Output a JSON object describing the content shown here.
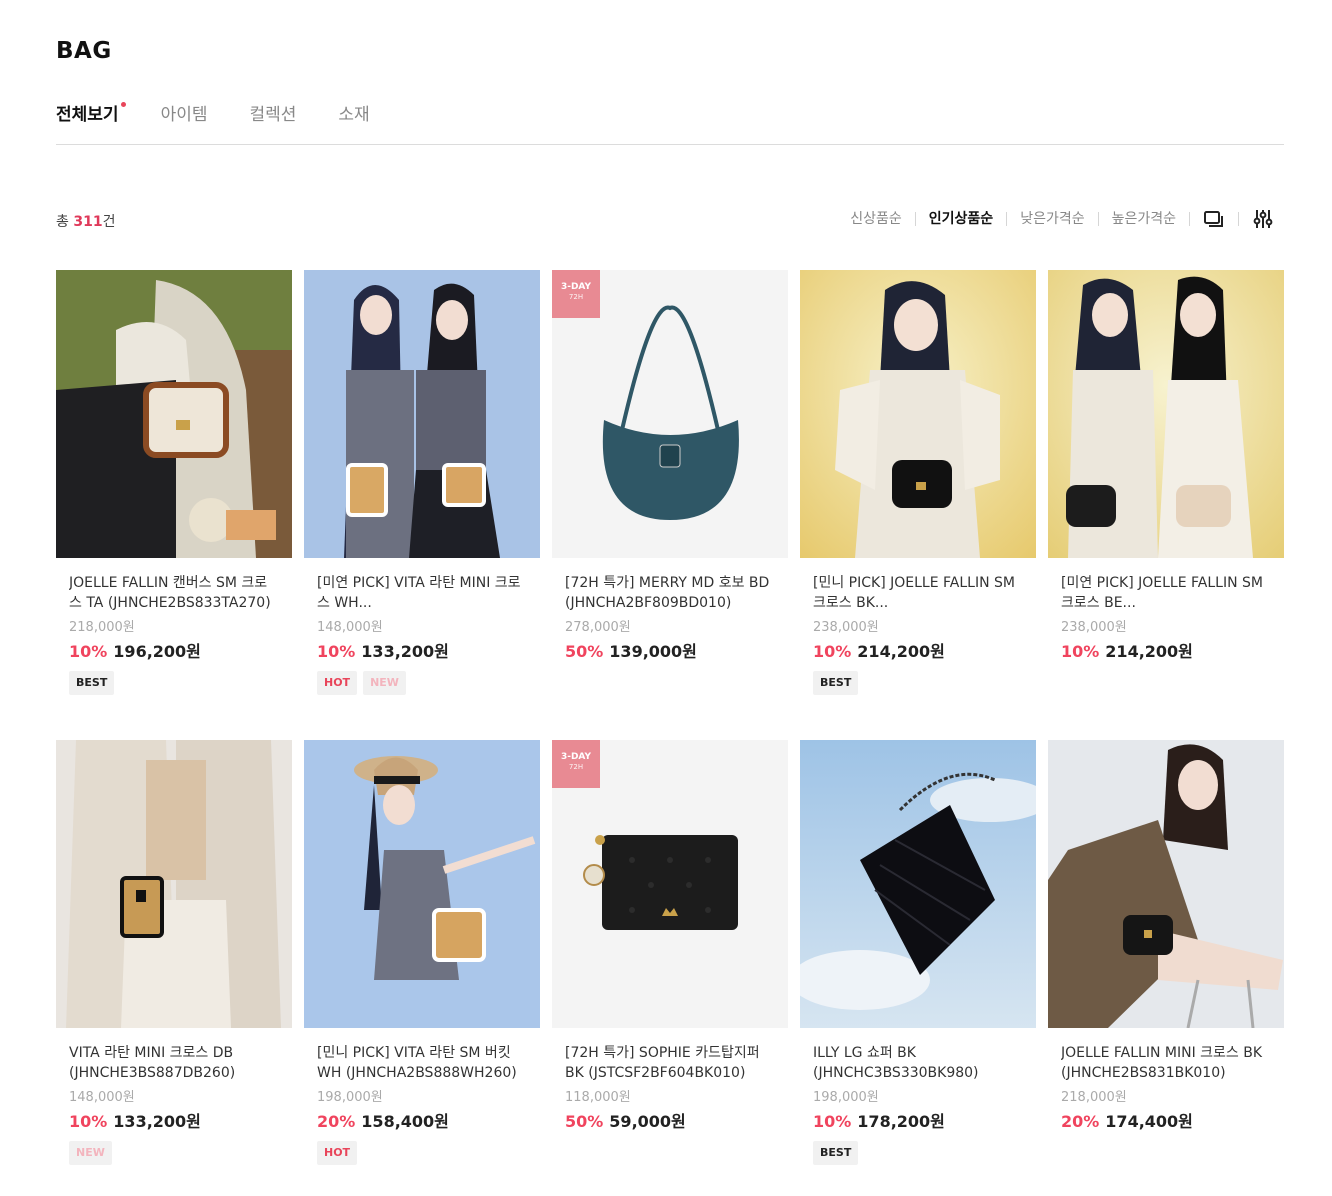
{
  "page": {
    "title": "BAG"
  },
  "tabs": [
    {
      "label": "전체보기",
      "active": true
    },
    {
      "label": "아이템",
      "active": false
    },
    {
      "label": "컬렉션",
      "active": false
    },
    {
      "label": "소재",
      "active": false
    }
  ],
  "count": {
    "prefix": "총 ",
    "number": "311",
    "suffix": "건"
  },
  "sort": {
    "options": [
      "신상품순",
      "인기상품순",
      "낮은가격순",
      "높은가격순"
    ],
    "active": "인기상품순",
    "icons": [
      "view-toggle-icon",
      "filter-sliders-icon"
    ]
  },
  "ribbon": {
    "line1": "3-DAY",
    "line2": "72H"
  },
  "products": [
    {
      "name": "JOELLE FALLIN 캔버스 SM 크로스 TA (JHNCHE2BS833TA270)",
      "original": "218,000원",
      "discount": "10%",
      "price": "196,200원",
      "badges": [
        "BEST"
      ],
      "ribbon": false
    },
    {
      "name": "[미연 PICK] VITA 라탄 MINI 크로스 WH...",
      "original": "148,000원",
      "discount": "10%",
      "price": "133,200원",
      "badges": [
        "HOT",
        "NEW"
      ],
      "ribbon": false
    },
    {
      "name": "[72H 특가] MERRY MD 호보 BD (JHNCHA2BF809BD010)",
      "original": "278,000원",
      "discount": "50%",
      "price": "139,000원",
      "badges": [],
      "ribbon": true
    },
    {
      "name": "[민니 PICK] JOELLE FALLIN SM 크로스 BK...",
      "original": "238,000원",
      "discount": "10%",
      "price": "214,200원",
      "badges": [
        "BEST"
      ],
      "ribbon": false
    },
    {
      "name": "[미연 PICK] JOELLE FALLIN SM 크로스 BE...",
      "original": "238,000원",
      "discount": "10%",
      "price": "214,200원",
      "badges": [],
      "ribbon": false
    },
    {
      "name": "VITA 라탄 MINI 크로스 DB (JHNCHE3BS887DB260)",
      "original": "148,000원",
      "discount": "10%",
      "price": "133,200원",
      "badges": [
        "NEW"
      ],
      "ribbon": false
    },
    {
      "name": "[민니 PICK] VITA 라탄 SM 버킷 WH (JHNCHA2BS888WH260)",
      "original": "198,000원",
      "discount": "20%",
      "price": "158,400원",
      "badges": [
        "HOT"
      ],
      "ribbon": false
    },
    {
      "name": "[72H 특가] SOPHIE 카드탑지퍼 BK (JSTCSF2BF604BK010)",
      "original": "118,000원",
      "discount": "50%",
      "price": "59,000원",
      "badges": [],
      "ribbon": true
    },
    {
      "name": "ILLY LG 쇼퍼 BK (JHNCHC3BS330BK980)",
      "original": "198,000원",
      "discount": "10%",
      "price": "178,200원",
      "badges": [
        "BEST"
      ],
      "ribbon": false
    },
    {
      "name": "JOELLE FALLIN MINI 크로스 BK (JHNCHE2BS831BK010)",
      "original": "218,000원",
      "discount": "20%",
      "price": "174,400원",
      "badges": [],
      "ribbon": false
    }
  ],
  "colors": {
    "accent": "#e0395a",
    "discount": "#f0445e",
    "ribbon": "#e88a93"
  }
}
